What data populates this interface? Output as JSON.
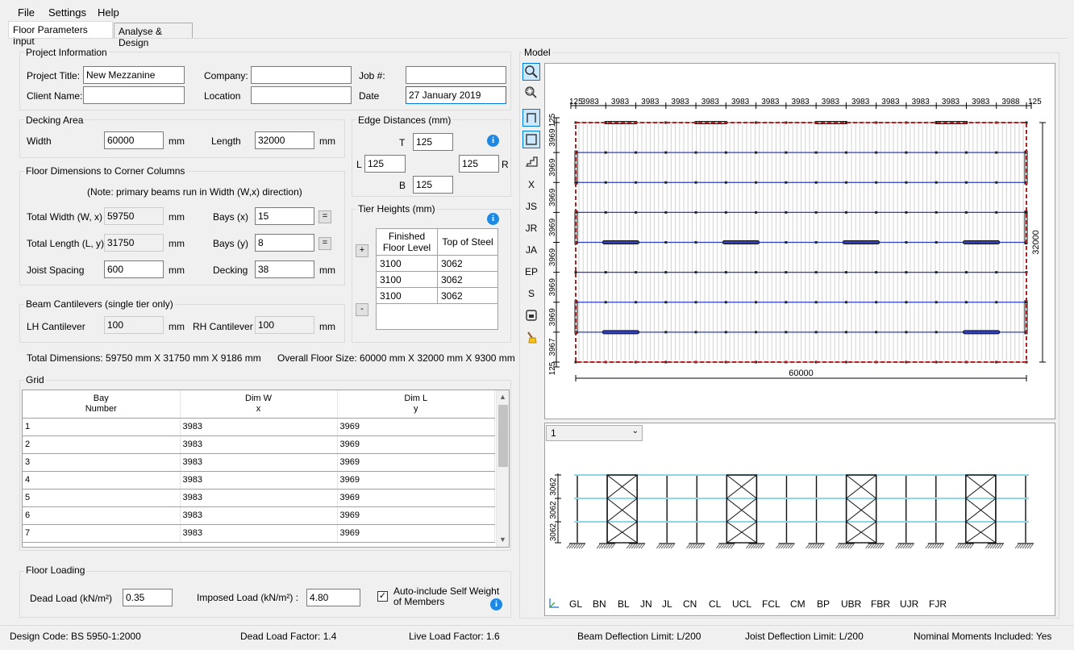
{
  "menu": {
    "file": "File",
    "settings": "Settings",
    "help": "Help"
  },
  "tabs": {
    "floor_params": "Floor Parameters Input",
    "analyse": "Analyse & Design"
  },
  "project": {
    "title": "Project Information",
    "project_title_label": "Project Title:",
    "project_title": "New Mezzanine",
    "company_label": "Company:",
    "company": "",
    "job_label": "Job #:",
    "job": "",
    "client_label": "Client Name:",
    "client": "",
    "location_label": "Location",
    "location": "",
    "date_label": "Date",
    "date": "27 January 2019"
  },
  "decking": {
    "title": "Decking Area",
    "width_label": "Width",
    "width": "60000",
    "width_unit": "mm",
    "length_label": "Length",
    "length": "32000",
    "length_unit": "mm"
  },
  "edge": {
    "title": "Edge Distances (mm)",
    "t_label": "T",
    "t": "125",
    "l_label": "L",
    "l": "125",
    "r_label": "R",
    "r": "125",
    "b_label": "B",
    "b": "125"
  },
  "floor_dims": {
    "title": "Floor Dimensions to Corner Columns",
    "note": "(Note: primary beams run in Width (W,x) direction)",
    "total_width_label": "Total Width (W, x)",
    "total_width": "59750",
    "tw_unit": "mm",
    "bays_x_label": "Bays (x)",
    "bays_x": "15",
    "total_length_label": "Total Length (L, y)",
    "total_length": "31750",
    "tl_unit": "mm",
    "bays_y_label": "Bays (y)",
    "bays_y": "8",
    "joist_label": "Joist Spacing",
    "joist": "600",
    "joist_unit": "mm",
    "decking_label": "Decking",
    "decking": "38",
    "decking_unit": "mm",
    "eq": "="
  },
  "tier": {
    "title": "Tier Heights (mm)",
    "col1": "Finished Floor Level",
    "col2": "Top of Steel",
    "rows": [
      [
        "3100",
        "3062"
      ],
      [
        "3100",
        "3062"
      ],
      [
        "3100",
        "3062"
      ]
    ],
    "add": "+",
    "remove": "-"
  },
  "cantilevers": {
    "title": "Beam Cantilevers (single tier only)",
    "lh_label": "LH Cantilever",
    "lh": "100",
    "lh_unit": "mm",
    "rh_label": "RH Cantilever",
    "rh": "100",
    "rh_unit": "mm"
  },
  "totals": {
    "total": "Total Dimensions: 59750 mm X 31750 mm X 9186 mm",
    "overall": "Overall Floor Size: 60000 mm X 32000 mm X 9300 mm"
  },
  "grid": {
    "title": "Grid",
    "h1a": "Bay",
    "h1b": "Number",
    "h2a": "Dim W",
    "h2b": "x",
    "h3a": "Dim L",
    "h3b": "y",
    "rows": [
      [
        "1",
        "3983",
        "3969"
      ],
      [
        "2",
        "3983",
        "3969"
      ],
      [
        "3",
        "3983",
        "3969"
      ],
      [
        "4",
        "3983",
        "3969"
      ],
      [
        "5",
        "3983",
        "3969"
      ],
      [
        "6",
        "3983",
        "3969"
      ],
      [
        "7",
        "3983",
        "3969"
      ]
    ]
  },
  "loading": {
    "title": "Floor Loading",
    "dead_label": "Dead Load (kN/m²)",
    "dead": "0.35",
    "imposed_label": "Imposed Load (kN/m²) :",
    "imposed": "4.80",
    "auto_label_1": "Auto-include Self Weight",
    "auto_label_2": "of Members",
    "auto_checked": "✓"
  },
  "model": {
    "title": "Model",
    "toolbar": [
      "X",
      "JS",
      "JR",
      "JA",
      "EP",
      "S"
    ],
    "top_dims": [
      "125",
      "3983",
      "3983",
      "3983",
      "3983",
      "3983",
      "3983",
      "3983",
      "3983",
      "3983",
      "3983",
      "3983",
      "3983",
      "3983",
      "3983",
      "3988",
      "125"
    ],
    "left_dims": [
      "125",
      "3969",
      "3969",
      "3969",
      "3969",
      "3969",
      "3969",
      "3969",
      "3967",
      "125"
    ],
    "right_dim": "32000",
    "bottom_dim": "60000",
    "tier_select": "1",
    "elev_dims": [
      "3062",
      "3062",
      "3062"
    ],
    "layers": [
      "GL",
      "BN",
      "BL",
      "JN",
      "JL",
      "CN",
      "CL",
      "UCL",
      "FCL",
      "CM",
      "BP",
      "UBR",
      "FBR",
      "UJR",
      "FJR"
    ]
  },
  "status": {
    "design_code": "Design Code:  BS 5950-1:2000",
    "dead_factor": "Dead Load Factor: 1.4",
    "live_factor": "Live Load Factor: 1.6",
    "beam_defl": "Beam Deflection Limit: L/200",
    "joist_defl": "Joist Deflection Limit: L/200",
    "moments": "Nominal Moments Included: Yes"
  },
  "colors": {
    "accent": "#0078d7",
    "beam": "#2e3fc2",
    "edge": "#b22222",
    "elev_beam": "#8fd6e8"
  }
}
